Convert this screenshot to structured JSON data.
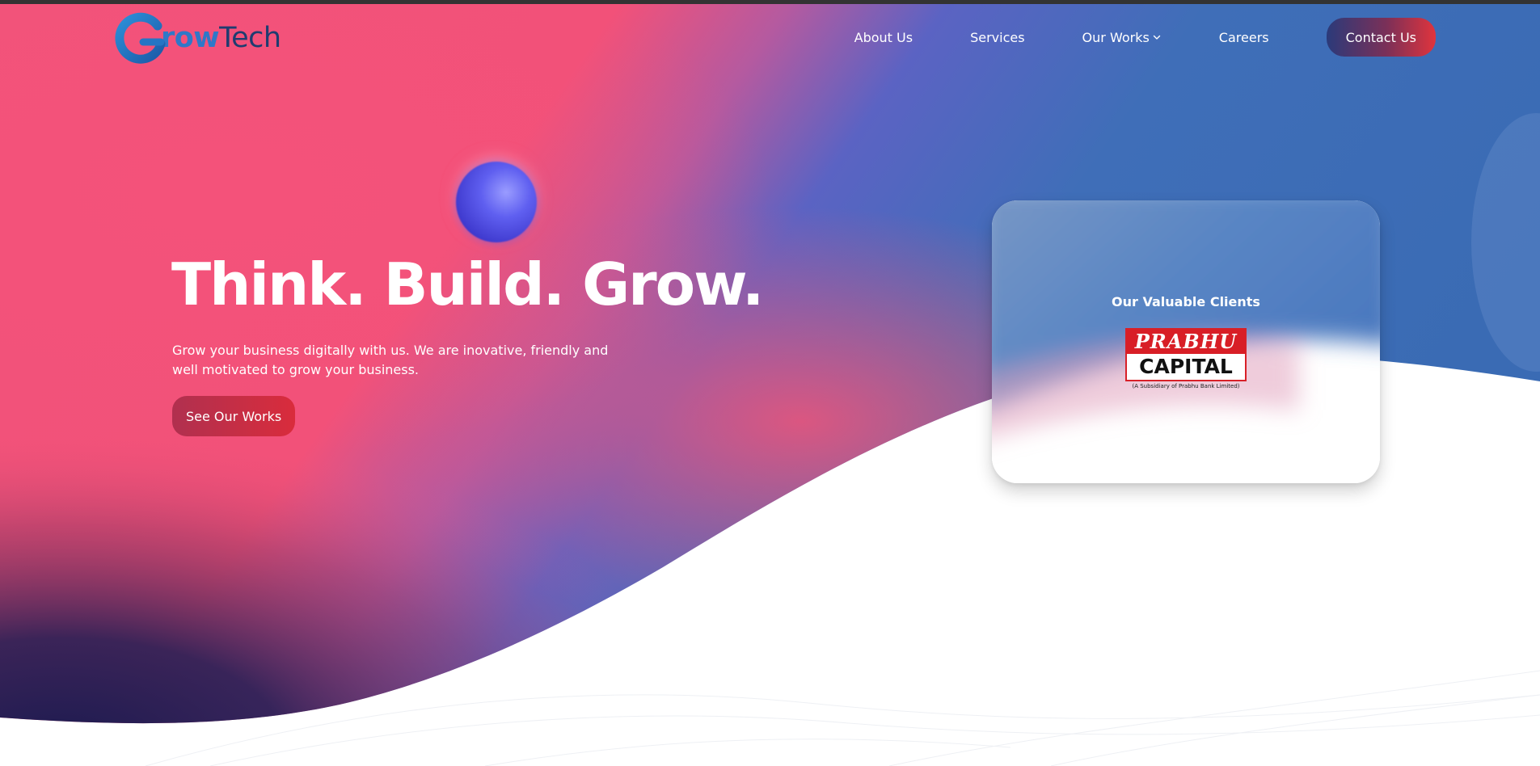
{
  "brand": {
    "logo_g": "G",
    "logo_text_colored": "row",
    "logo_text_plain": "Tech",
    "logo_full": "GrowTech",
    "colors": {
      "pink": "#f2537a",
      "blue": "#3a6db5",
      "navy": "#1c1c52",
      "accent_red": "#e0343d",
      "logo_blue": "#2f78c8"
    }
  },
  "nav": {
    "items": [
      {
        "label": "About Us",
        "name": "nav-about-us"
      },
      {
        "label": "Services",
        "name": "nav-services"
      },
      {
        "label": "Our Works",
        "name": "nav-our-works",
        "dropdown": true,
        "icon": "chevron-down-icon"
      },
      {
        "label": "Careers",
        "name": "nav-careers"
      }
    ],
    "contact_label": "Contact Us"
  },
  "hero": {
    "title": "Think. Build. Grow.",
    "subtitle": "Grow your business digitally with us. We are inovative, friendly and well motivated to grow your business.",
    "cta_label": "See Our Works"
  },
  "clients": {
    "title": "Our Valuable Clients",
    "logos": [
      {
        "name": "prabhu-capital",
        "top_text": "PRABHU",
        "bottom_text": "CAPITAL",
        "caption": "(A Subsidiary of Prabhu Bank Limited)"
      }
    ]
  }
}
